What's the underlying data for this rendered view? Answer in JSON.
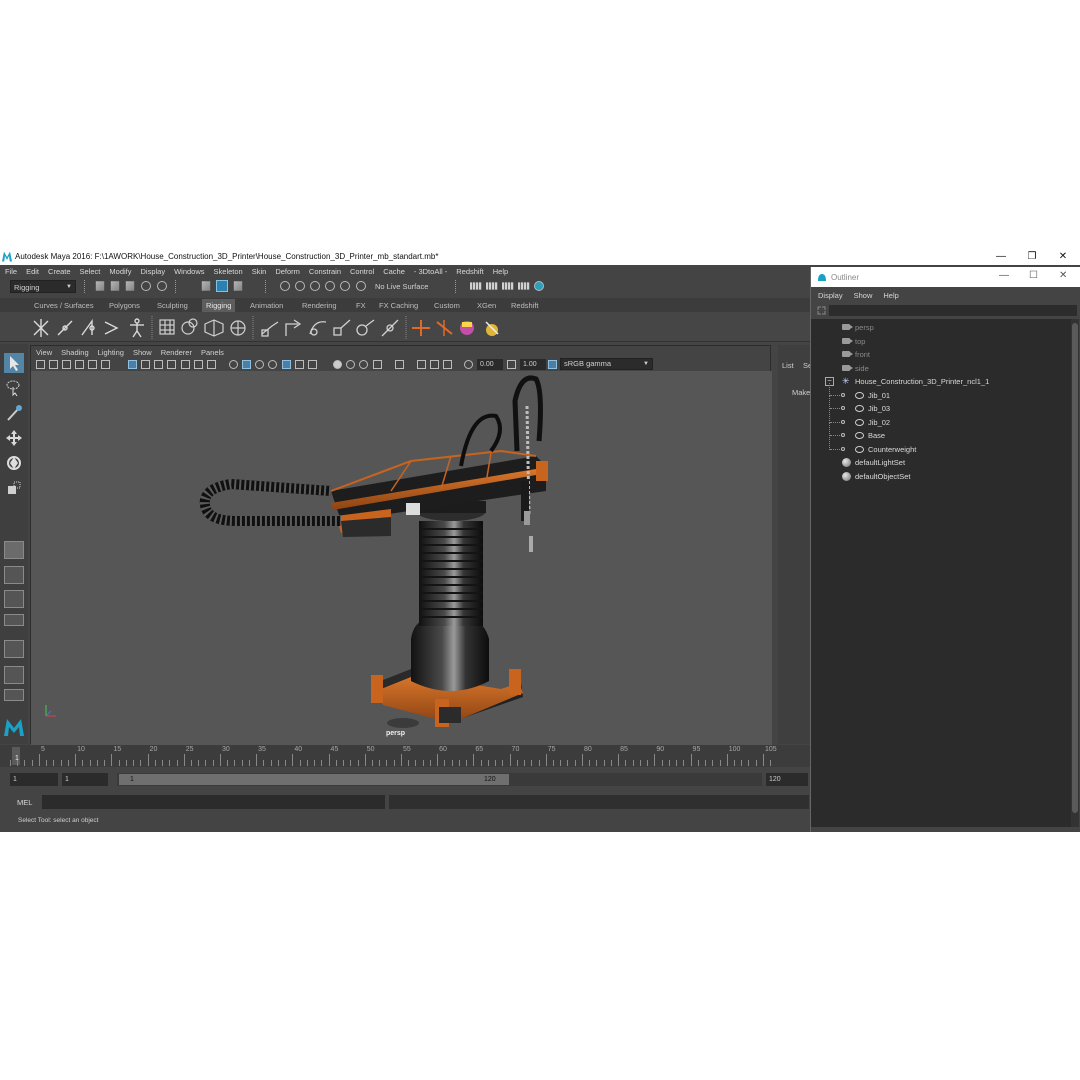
{
  "window": {
    "title": "Autodesk Maya 2016: F:\\1AWORK\\House_Construction_3D_Printer\\House_Construction_3D_Printer_mb_standart.mb*",
    "minimize_glyph": "—",
    "restore_glyph": "❐",
    "close_glyph": "✕"
  },
  "menubar": [
    "File",
    "Edit",
    "Create",
    "Select",
    "Modify",
    "Display",
    "Windows",
    "Skeleton",
    "Skin",
    "Deform",
    "Constrain",
    "Control",
    "Cache",
    "- 3DtoAll -",
    "Redshift",
    "Help"
  ],
  "status_line": {
    "menuset": "Rigging",
    "live_surface": "No Live Surface"
  },
  "shelf": {
    "tabs": [
      "Curves / Surfaces",
      "Polygons",
      "Sculpting",
      "Rigging",
      "Animation",
      "Rendering",
      "FX",
      "FX Caching",
      "Custom",
      "XGen",
      "Redshift"
    ],
    "active_tab": "Rigging"
  },
  "viewport": {
    "menu": [
      "View",
      "Shading",
      "Lighting",
      "Show",
      "Renderer",
      "Panels"
    ],
    "exposure": "0.00",
    "gamma": "1.00",
    "color_space": "sRGB gamma",
    "camera_label": "persp",
    "axis_glyph": "↳"
  },
  "right_panel": {
    "tabs": [
      "List",
      "Se"
    ],
    "make": "Make"
  },
  "timeline": {
    "ticks": [
      "5",
      "10",
      "15",
      "20",
      "25",
      "30",
      "35",
      "40",
      "45",
      "50",
      "55",
      "60",
      "65",
      "70",
      "75",
      "80",
      "85",
      "90",
      "95",
      "100",
      "105"
    ],
    "current_frame": "1"
  },
  "range": {
    "start": "1",
    "playback_start": "1",
    "slider_start": "1",
    "slider_end": "120",
    "end": "120"
  },
  "command_line": {
    "label": "MEL"
  },
  "help_line": "Select Tool: select an object",
  "outliner": {
    "title": "Outliner",
    "menu": [
      "Display",
      "Show",
      "Help"
    ],
    "items": [
      {
        "label": "persp",
        "type": "camera",
        "depth": 0
      },
      {
        "label": "top",
        "type": "camera",
        "depth": 0
      },
      {
        "label": "front",
        "type": "camera",
        "depth": 0
      },
      {
        "label": "side",
        "type": "camera",
        "depth": 0
      },
      {
        "label": "House_Construction_3D_Printer_ncl1_1",
        "type": "joint-root",
        "depth": 0
      },
      {
        "label": "Jib_01",
        "type": "joint",
        "depth": 1
      },
      {
        "label": "Jib_03",
        "type": "joint",
        "depth": 1
      },
      {
        "label": "Jib_02",
        "type": "joint",
        "depth": 1
      },
      {
        "label": "Base",
        "type": "joint",
        "depth": 1
      },
      {
        "label": "Counterweight",
        "type": "joint",
        "depth": 1
      },
      {
        "label": "defaultLightSet",
        "type": "set",
        "depth": 0
      },
      {
        "label": "defaultObjectSet",
        "type": "set",
        "depth": 0
      }
    ],
    "collapse_glyph": "−"
  },
  "colors": {
    "panel": "#444444",
    "viewport_bg": "#565656",
    "selected_tool": "#5285a6",
    "printer_orange": "#c8641e",
    "maya_accent": "#1aa1c6"
  }
}
